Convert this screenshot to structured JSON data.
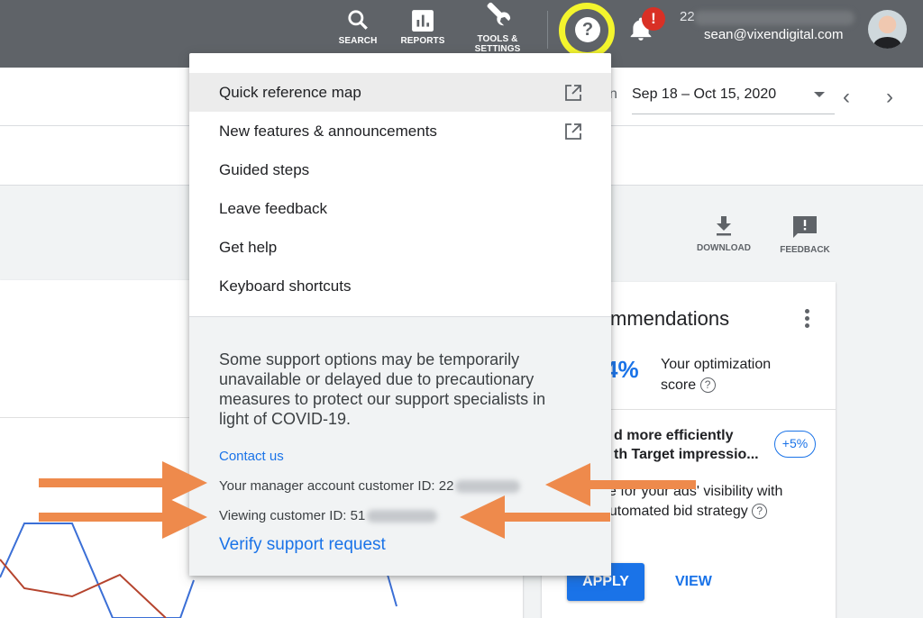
{
  "topbar": {
    "search_label": "SEARCH",
    "reports_label": "REPORTS",
    "tools_label_line1": "TOOLS &",
    "tools_label_line2": "SETTINGS",
    "help_icon": "question-mark-icon",
    "notifications_badge": "!",
    "account_id_visible": "22",
    "account_email": "sean@vixendigital.com"
  },
  "date_picker": {
    "prefix_partial": "n",
    "range": "Sep 18 – Oct 15, 2020",
    "prev_icon": "‹",
    "next_icon": "›"
  },
  "actions": {
    "download_label": "DOWNLOAD",
    "feedback_label": "FEEDBACK"
  },
  "help_menu": {
    "items": [
      {
        "label": "Quick reference map",
        "external": true,
        "highlighted": true
      },
      {
        "label": "New features & announcements",
        "external": true,
        "highlighted": false
      },
      {
        "label": "Guided steps",
        "external": false,
        "highlighted": false
      },
      {
        "label": "Leave feedback",
        "external": false,
        "highlighted": false
      },
      {
        "label": "Get help",
        "external": false,
        "highlighted": false
      },
      {
        "label": "Keyboard shortcuts",
        "external": false,
        "highlighted": false
      }
    ],
    "support_notice": "Some support options may be temporarily unavailable or delayed due to precautionary measures to protect our support specialists in light of COVID-19.",
    "contact_label": "Contact us",
    "manager_id_label": "Your manager account customer ID: 22",
    "viewing_id_label": "Viewing customer ID: 51",
    "verify_label": "Verify support request"
  },
  "recommendations": {
    "title_partial": "mmendations",
    "score_partial": "4%",
    "score_label": "Your optimization score",
    "item_title": "d more efficiently\nth Target impressio...",
    "item_title_line1": "d more efficiently",
    "item_title_line2": "th Target impressio...",
    "uplift": "+5%",
    "item_desc_line1": "ze for your ads' visibility with",
    "item_desc_line2": "automated bid strategy",
    "apply_label": "APPLY",
    "view_label": "VIEW"
  },
  "colors": {
    "topbar": "#5f6368",
    "accent_blue": "#1a73e8",
    "highlight_ring": "#f4f52d",
    "annotation_arrow": "#ee8a4c",
    "series_blue": "#3b6fd6",
    "series_red": "#b5442e",
    "badge_red": "#d93025"
  }
}
